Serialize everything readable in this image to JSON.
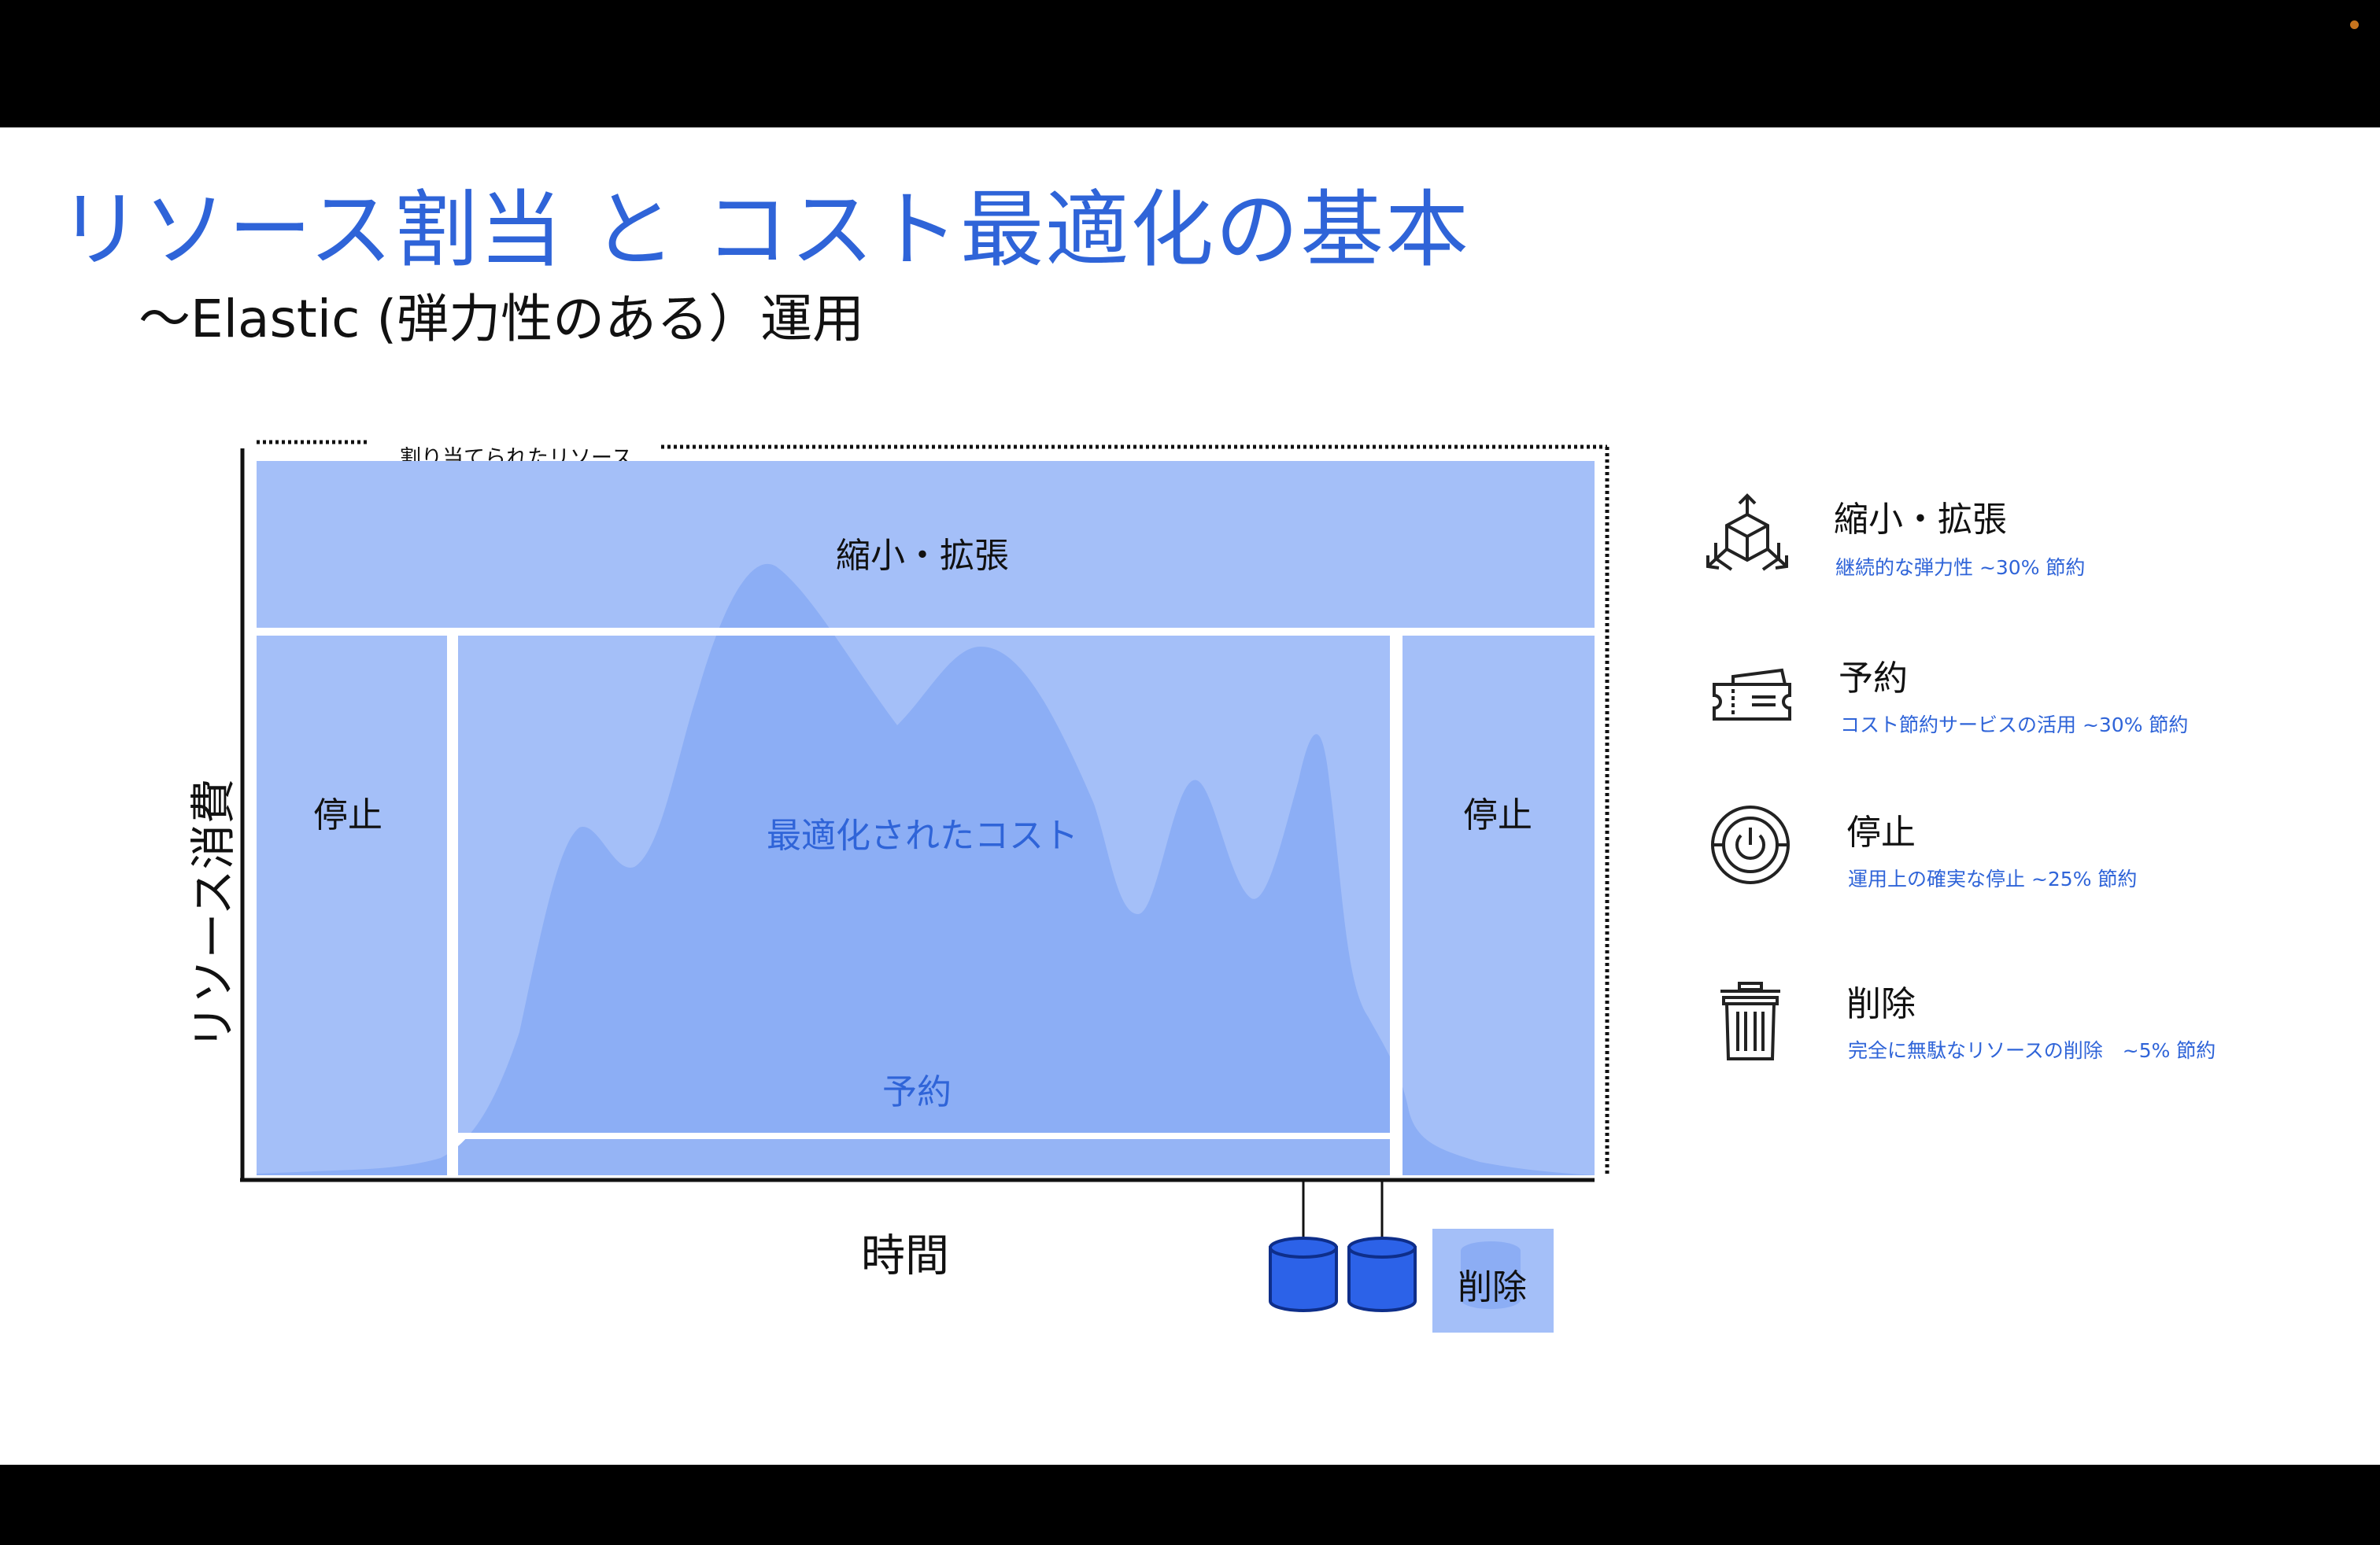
{
  "title": "リソース割当 と コスト最適化の基本",
  "subtitle": "～Elastic (弾力性のある）運用",
  "diagram": {
    "allocated_label": "割り当てられたリソース",
    "y_axis_label": "リソース消費",
    "x_axis_label": "時間",
    "boxes": {
      "scale": "縮小・拡張",
      "stop_left": "停止",
      "stop_right": "停止",
      "optimized": "最適化されたコスト",
      "reserved": "予約",
      "delete": "削除"
    },
    "colors": {
      "accent": "#2f64d8",
      "box": "#a4bff8",
      "area": "#8aacf4",
      "db": "#2c62e8"
    }
  },
  "legend": [
    {
      "icon": "scale-cube-icon",
      "title": "縮小・拡張",
      "sub": "継続的な弾力性 ~30% 節約"
    },
    {
      "icon": "ticket-icon",
      "title": "予約",
      "sub": "コスト節約サービスの活用 ~30% 節約"
    },
    {
      "icon": "power-icon",
      "title": "停止",
      "sub": "運用上の確実な停止 ~25% 節約"
    },
    {
      "icon": "trash-icon",
      "title": "削除",
      "sub": "完全に無駄なリソースの削除　~5% 節約"
    }
  ]
}
